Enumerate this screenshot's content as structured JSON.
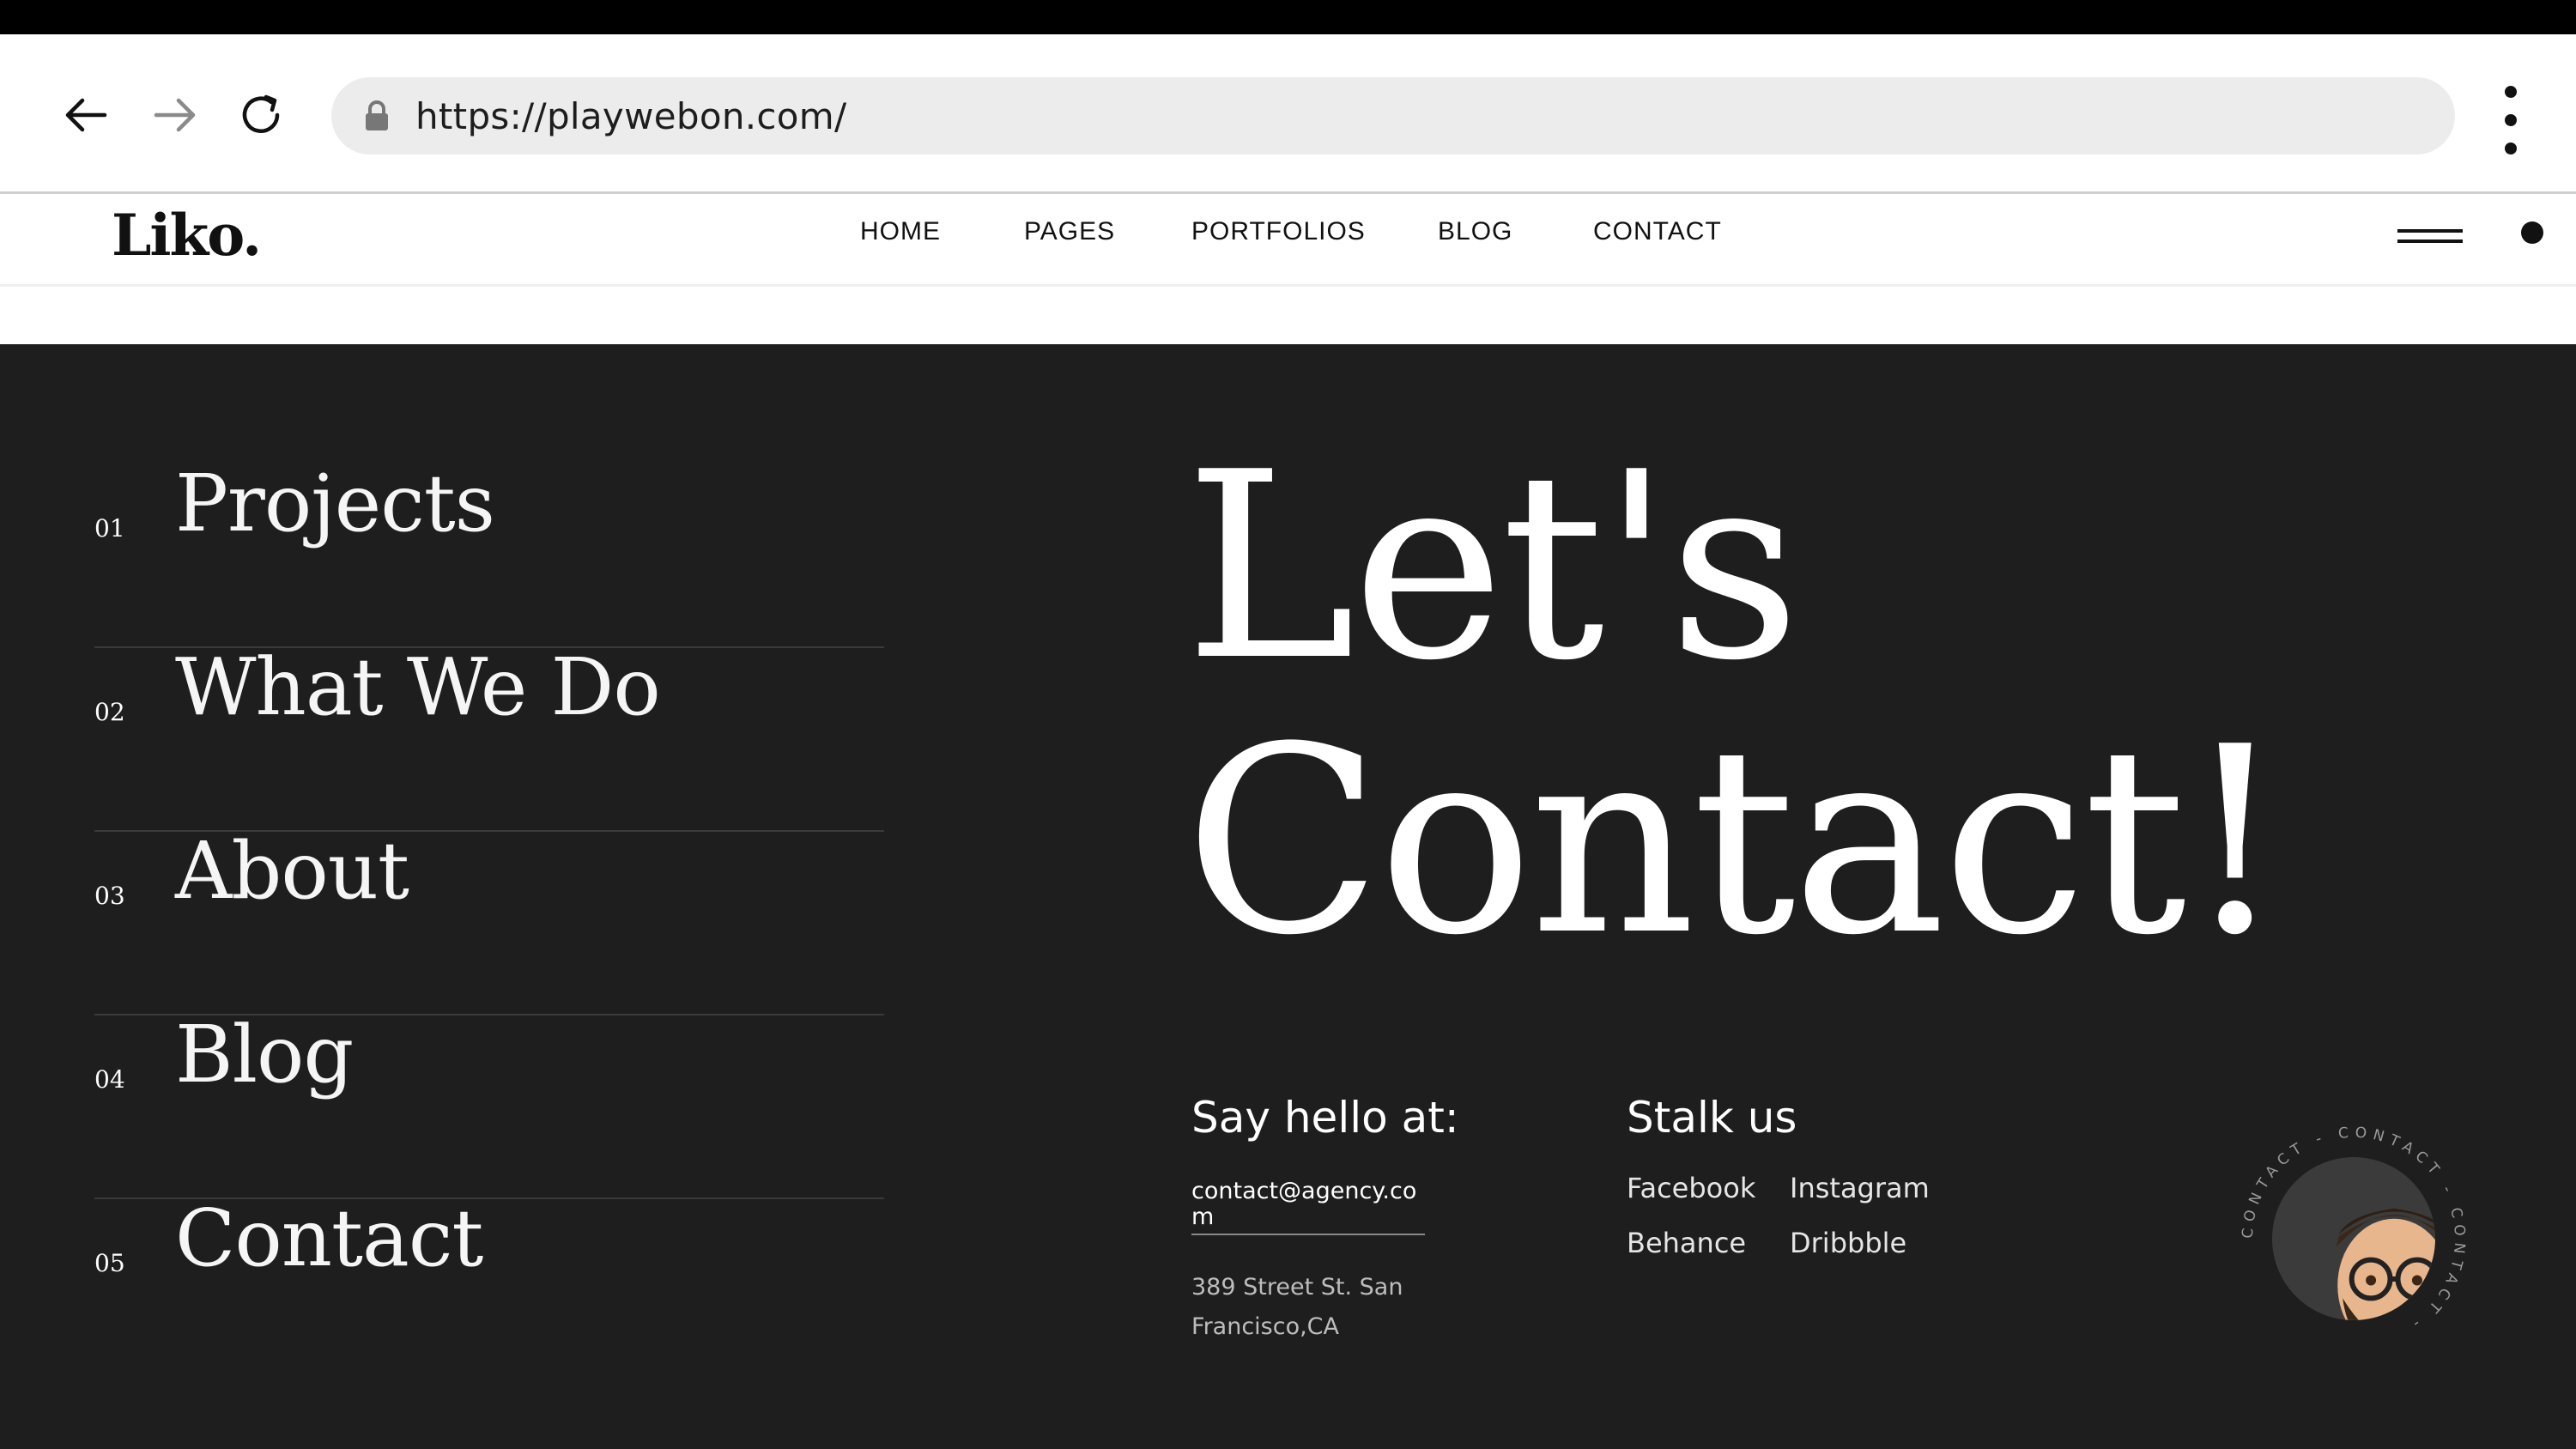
{
  "browser": {
    "url": "https://playwebon.com/",
    "back_icon": "arrow-left-icon",
    "forward_icon": "arrow-right-icon",
    "reload_icon": "reload-icon",
    "lock_icon": "lock-icon",
    "menu_icon": "kebab-menu-icon"
  },
  "header": {
    "logo": "Liko.",
    "menu": [
      {
        "label": "HOME"
      },
      {
        "label": "PAGES"
      },
      {
        "label": "PORTFOLIOS"
      },
      {
        "label": "BLOG"
      },
      {
        "label": "CONTACT"
      }
    ]
  },
  "side_nav": {
    "items": [
      {
        "num": "01",
        "label": "Projects"
      },
      {
        "num": "02",
        "label": "What We Do"
      },
      {
        "num": "03",
        "label": "About"
      },
      {
        "num": "04",
        "label": "Blog"
      },
      {
        "num": "05",
        "label": "Contact"
      }
    ]
  },
  "hero": {
    "line1": "Let's",
    "line2": "Contact!"
  },
  "say_hello": {
    "title": "Say hello at:",
    "email": "contact@agency.com",
    "address": "389 Street St. San Francisco,CA"
  },
  "stalk": {
    "title": "Stalk us",
    "links": [
      "Facebook",
      "Instagram",
      "Behance",
      "Dribbble"
    ]
  },
  "badge": {
    "ring_text": "CONTACT - CONTACT - CONTACT - ",
    "avatar_icon": "memoji-thumbs-up-avatar"
  },
  "colors": {
    "dark_bg": "#1e1e1e",
    "text_light": "#ffffff",
    "text_muted": "#bdbdbd",
    "url_bar": "#ececec"
  }
}
